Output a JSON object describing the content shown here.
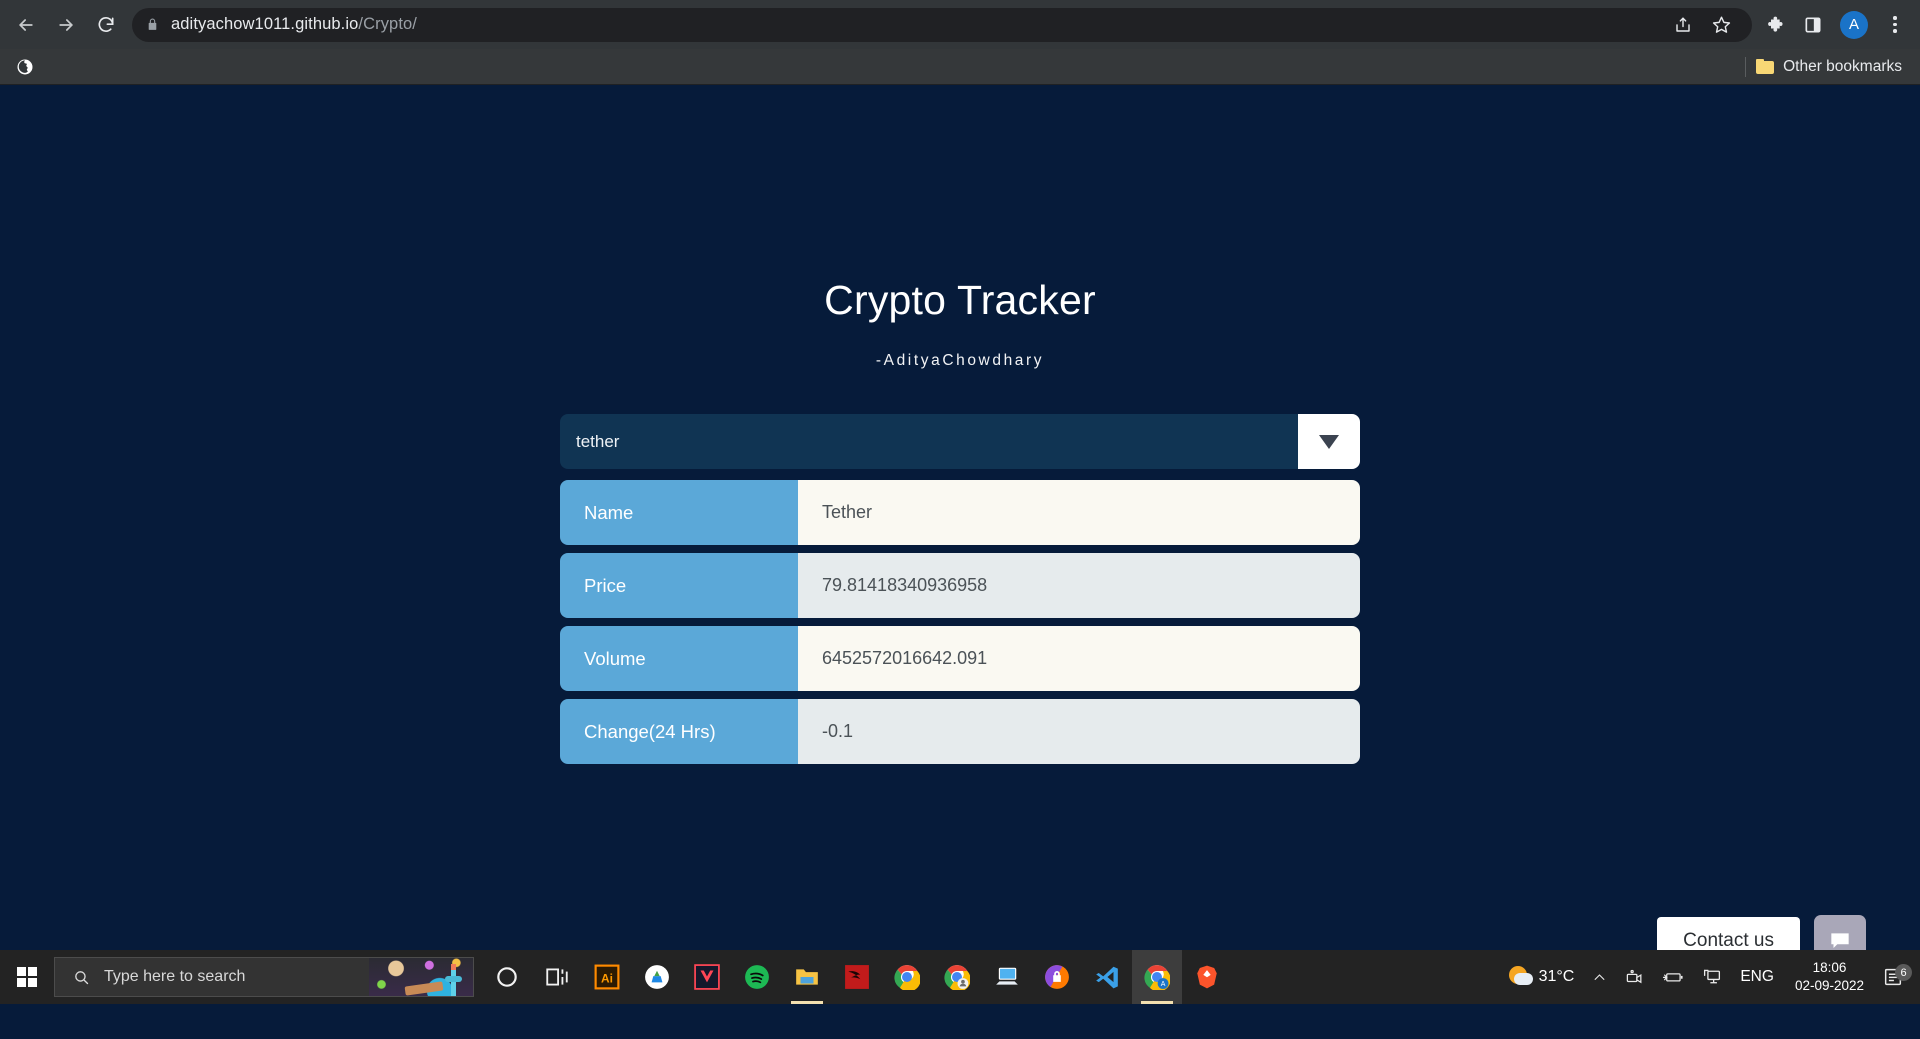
{
  "browser": {
    "nav": {
      "back_label": "Back",
      "forward_label": "Forward",
      "reload_label": "Reload"
    },
    "omnibox": {
      "domain": "adityachow1011.github.io",
      "path": "/Crypto/",
      "lock_icon": "lock-icon",
      "share_icon": "share-icon",
      "bookmark_icon": "star-icon"
    },
    "toolbar": {
      "extensions_icon": "puzzle-icon",
      "side_panel_icon": "side-panel-icon",
      "profile_initial": "A",
      "menu_icon": "three-dots-icon"
    },
    "bookmarks": {
      "site_icon": "globe-icon",
      "other_bookmarks_label": "Other bookmarks",
      "folder_icon": "folder-icon"
    }
  },
  "page": {
    "title": "Crypto Tracker",
    "subtitle": "-AdityaChowdhary",
    "selector": {
      "value": "tether",
      "caret_icon": "chevron-down-icon"
    },
    "table": {
      "rows": [
        {
          "label": "Name",
          "value": "Tether"
        },
        {
          "label": "Price",
          "value": "79.81418340936958"
        },
        {
          "label": "Volume",
          "value": "6452572016642.091"
        },
        {
          "label": "Change(24 Hrs)",
          "value": "-0.1"
        }
      ]
    },
    "contact": {
      "button_label": "Contact us",
      "chat_icon": "chat-bubble-icon"
    },
    "colors": {
      "background": "#061b3a",
      "label_cell": "#5ba8d8",
      "value_cell_a": "#faf9f2",
      "value_cell_b": "#e6ebed",
      "select_field": "#103453"
    }
  },
  "taskbar": {
    "start_icon": "windows-start-icon",
    "search_placeholder": "Type here to search",
    "search_icon": "search-icon",
    "apps": [
      {
        "name": "cortana-icon"
      },
      {
        "name": "task-view-icon"
      },
      {
        "name": "adobe-illustrator-icon",
        "label": "Ai"
      },
      {
        "name": "whatsapp-icon"
      },
      {
        "name": "valorant-icon"
      },
      {
        "name": "spotify-icon"
      },
      {
        "name": "file-explorer-icon"
      },
      {
        "name": "kali-linux-icon"
      },
      {
        "name": "chrome-icon"
      },
      {
        "name": "chrome-profile-icon"
      },
      {
        "name": "remote-desktop-icon"
      },
      {
        "name": "avast-icon"
      },
      {
        "name": "vscode-icon"
      },
      {
        "name": "chrome-active-icon"
      },
      {
        "name": "brave-icon"
      }
    ],
    "tray": {
      "weather_icon": "weather-icon",
      "temperature": "31°C",
      "overflow_icon": "chevron-up-icon",
      "camera_icon": "camera-icon",
      "battery_icon": "battery-icon",
      "network_icon": "network-display-icon",
      "language": "ENG",
      "time": "18:06",
      "date": "02-09-2022",
      "notification_icon": "notification-icon",
      "notification_count": "6"
    }
  }
}
